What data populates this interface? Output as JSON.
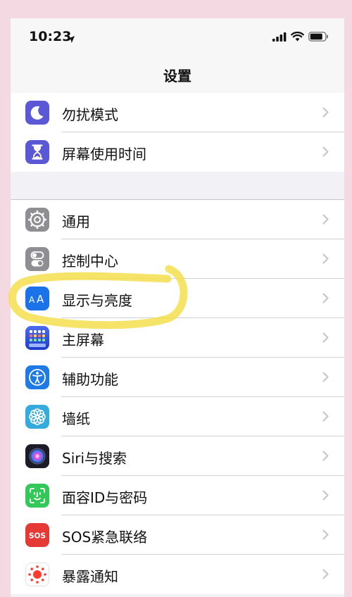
{
  "status_bar": {
    "time": "10:23"
  },
  "nav": {
    "title": "设置"
  },
  "group1": [
    {
      "label": "勿扰模式",
      "icon": "moon-icon",
      "color": "#5b58d6"
    },
    {
      "label": "屏幕使用时间",
      "icon": "hourglass-icon",
      "color": "#5b58d6"
    }
  ],
  "group2": [
    {
      "label": "通用",
      "icon": "gear-icon",
      "color": "#8e8e93"
    },
    {
      "label": "控制中心",
      "icon": "toggles-icon",
      "color": "#8e8e93"
    },
    {
      "label": "显示与亮度",
      "icon": "text-size-icon",
      "color": "#1a73e8"
    },
    {
      "label": "主屏幕",
      "icon": "home-grid-icon",
      "color": "#2c4fd6"
    },
    {
      "label": "辅助功能",
      "icon": "accessibility-icon",
      "color": "#1f7ae6"
    },
    {
      "label": "墙纸",
      "icon": "flower-icon",
      "color": "#35aadc"
    },
    {
      "label": "Siri与搜索",
      "icon": "siri-icon",
      "color": "#222233"
    },
    {
      "label": "面容ID与密码",
      "icon": "face-id-icon",
      "color": "#34c759"
    },
    {
      "label": "SOS紧急联络",
      "icon": "sos-icon",
      "color": "#e53935"
    },
    {
      "label": "暴露通知",
      "icon": "exposure-icon",
      "color": "#ffffff"
    }
  ],
  "sos_text": "SOS",
  "highlight_color": "#f5df4d"
}
